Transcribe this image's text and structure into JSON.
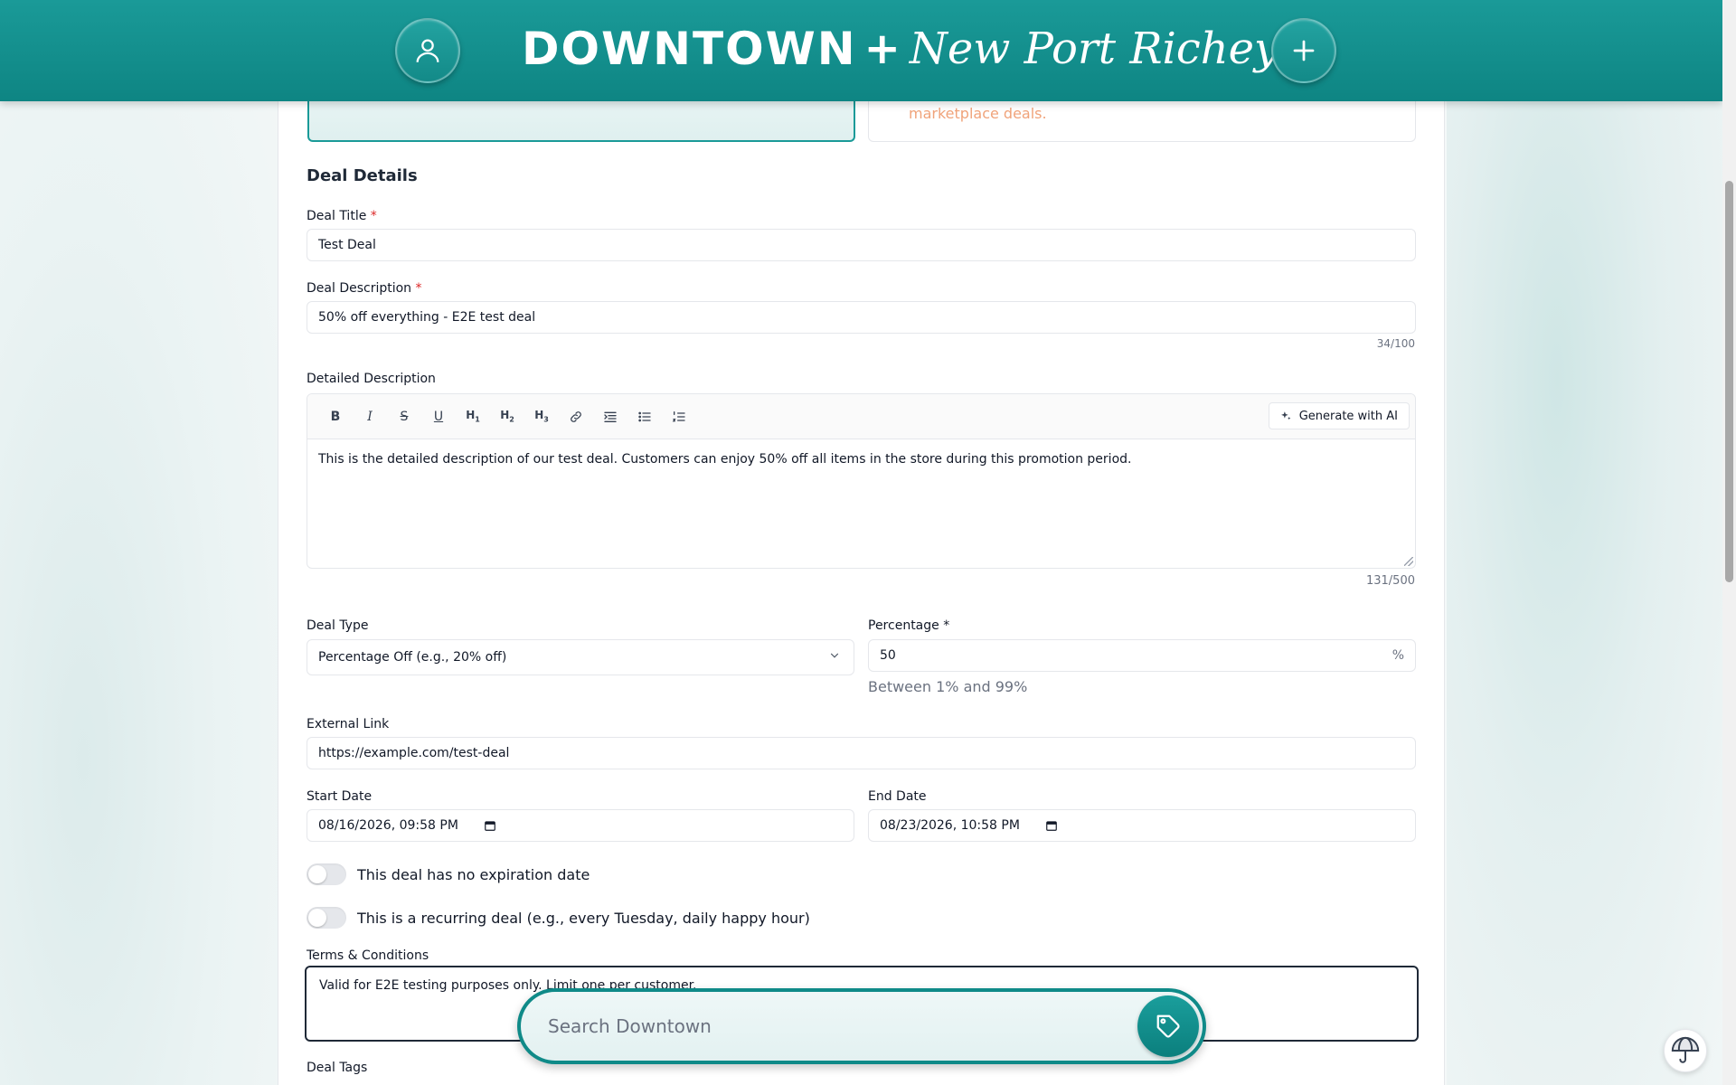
{
  "header": {
    "brand_main": "DOWNTOWN",
    "brand_plus": "+",
    "brand_city": "New Port Richey",
    "profile_icon": "user-icon",
    "add_icon": "plus-icon"
  },
  "upper": {
    "right_text": "marketplace deals."
  },
  "section_title": "Deal Details",
  "deal_title": {
    "label": "Deal Title",
    "required_mark": "*",
    "value": "Test Deal"
  },
  "deal_description": {
    "label": "Deal Description",
    "required_mark": "*",
    "value": "50% off everything - E2E test deal",
    "counter": "34/100"
  },
  "detailed_description": {
    "label": "Detailed Description",
    "toolbar": {
      "bold": "B",
      "italic": "I",
      "strike": "S",
      "underline": "U",
      "h1": "H",
      "h2": "H",
      "h3": "H",
      "h1_sub": "1",
      "h2_sub": "2",
      "h3_sub": "3",
      "generate_label": "Generate with AI"
    },
    "body": "This is the detailed description of our test deal. Customers can enjoy 50% off all items in the store during this promotion period.",
    "counter": "131/500"
  },
  "deal_type": {
    "label": "Deal Type",
    "value": "Percentage Off (e.g., 20% off)"
  },
  "percentage": {
    "label": "Percentage *",
    "value": "50",
    "suffix": "%",
    "hint": "Between 1% and 99%"
  },
  "external_link": {
    "label": "External Link",
    "value": "https://example.com/test-deal"
  },
  "start_date": {
    "label": "Start Date",
    "value": "08/16/2026, 09:58 PM"
  },
  "end_date": {
    "label": "End Date",
    "value": "08/23/2026, 10:58 PM"
  },
  "toggles": {
    "no_expiration": "This deal has no expiration date",
    "recurring": "This is a recurring deal (e.g., every Tuesday, daily happy hour)"
  },
  "terms": {
    "label": "Terms & Conditions",
    "value": "Valid for E2E testing purposes only. Limit one per customer."
  },
  "deal_tags": {
    "label": "Deal Tags"
  },
  "search": {
    "placeholder": "Search Downtown",
    "icon": "tag-icon"
  },
  "colors": {
    "brand_teal": "#0f8a88",
    "required_red": "#dc2626",
    "hint_orange": "#f0a37a"
  }
}
